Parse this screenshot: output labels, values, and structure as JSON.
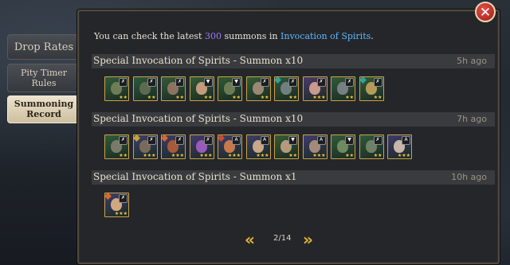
{
  "tabs": [
    {
      "label_lines": [
        "Drop Rates"
      ],
      "active": false
    },
    {
      "label_lines": [
        "Pity Timer",
        "Rules"
      ],
      "active": false
    },
    {
      "label_lines": [
        "Summoning",
        "Record"
      ],
      "active": true
    }
  ],
  "close_icon": "close-x-icon",
  "info": {
    "prefix": "You can check the latest ",
    "count": "300",
    "middle": " summons in ",
    "link": "Invocation of Spirits",
    "suffix": "."
  },
  "groups": [
    {
      "title": "Special Invocation of Spirits - Summon x10",
      "time": "5h ago",
      "heroes": [
        {
          "bg": "#2f5c3a",
          "face": "#6e7d55",
          "badge": "✗",
          "stars": "★★"
        },
        {
          "bg": "#2b5a3c",
          "face": "#5e6a50",
          "badge": "✗",
          "stars": "★★"
        },
        {
          "bg": "#355a38",
          "face": "#8b7360",
          "badge": "✗",
          "stars": "★★"
        },
        {
          "bg": "#335c37",
          "face": "#c49c7a",
          "badge": "▼",
          "stars": "★★"
        },
        {
          "bg": "#2e5a36",
          "face": "#6b7c55",
          "badge": "▼",
          "stars": "★★"
        },
        {
          "bg": "#315d39",
          "face": "#9d8773",
          "badge": "✗",
          "stars": "★★"
        },
        {
          "bg": "#2d593a",
          "face": "#727e80",
          "badge": "✗",
          "stars": "★★",
          "affinity": "#2aa3a3"
        },
        {
          "bg": "#4a3b6b",
          "face": "#c89a8c",
          "badge": "✗",
          "stars": "★★★"
        },
        {
          "bg": "#2f5b3a",
          "face": "#787f84",
          "badge": "✗",
          "stars": "★★"
        },
        {
          "bg": "#325c37",
          "face": "#b59a58",
          "badge": "✗",
          "stars": "★★",
          "affinity": "#2aa3a3"
        }
      ]
    },
    {
      "title": "Special Invocation of Spirits - Summon x10",
      "time": "7h ago",
      "heroes": [
        {
          "bg": "#2f5b39",
          "face": "#7a7a6a",
          "badge": "✗",
          "stars": "★★"
        },
        {
          "bg": "#3d3f6e",
          "face": "#7a6a5a",
          "badge": "✗",
          "stars": "★★★",
          "affinity": "#c9a230"
        },
        {
          "bg": "#3a3d6b",
          "face": "#a65a3a",
          "badge": "✗",
          "stars": "★★★",
          "affinity": "#e0662a"
        },
        {
          "bg": "#433a70",
          "face": "#9a5ab8",
          "badge": "✗",
          "stars": "★★★"
        },
        {
          "bg": "#3c3e6d",
          "face": "#c8784a",
          "badge": "A",
          "stars": "★★★",
          "affinity": "#d04a2a"
        },
        {
          "bg": "#3b3d6c",
          "face": "#c7a888",
          "badge": "A",
          "stars": "★★★"
        },
        {
          "bg": "#335c37",
          "face": "#b49a7c",
          "badge": "▼",
          "stars": "★★"
        },
        {
          "bg": "#3e3d6e",
          "face": "#a58a78",
          "badge": "A",
          "stars": "★★★"
        },
        {
          "bg": "#315b39",
          "face": "#6e8a5e",
          "badge": "▼",
          "stars": "★★"
        },
        {
          "bg": "#2f5a3a",
          "face": "#6f8068",
          "badge": "✗",
          "stars": "★★"
        },
        {
          "bg": "#3b3d6c",
          "face": "#c8b6a8",
          "badge": "A",
          "stars": "★★★"
        }
      ]
    },
    {
      "title": "Special Invocation of Spirits - Summon x1",
      "time": "10h ago",
      "heroes": [
        {
          "bg": "#3c3e6e",
          "face": "#d0a880",
          "badge": "✗",
          "stars": "★★★",
          "affinity": "#e0662a"
        }
      ]
    }
  ],
  "pager": {
    "prev_icon": "double-chevron-left-icon",
    "next_icon": "double-chevron-right-icon",
    "text": "2/14"
  }
}
